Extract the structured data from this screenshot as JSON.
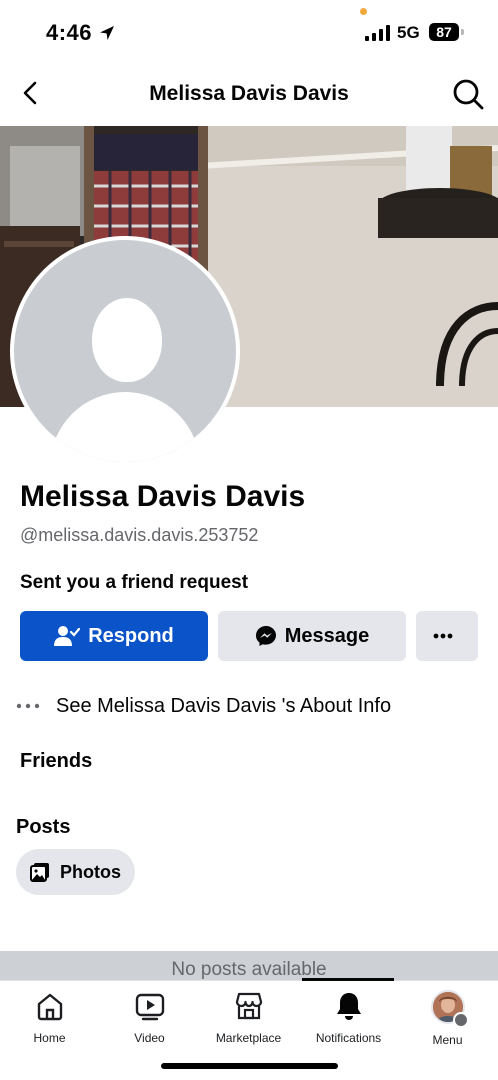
{
  "status_bar": {
    "time": "4:46",
    "network": "5G",
    "battery": "87",
    "icons": [
      "location-arrow-icon",
      "signal-icon",
      "battery-icon"
    ]
  },
  "header": {
    "title": "Melissa Davis Davis",
    "back_icon": "chevron-left-icon",
    "search_icon": "search-icon"
  },
  "profile": {
    "name": "Melissa Davis Davis",
    "handle": "@melissa.davis.davis.253752",
    "request_text": "Sent you a friend request",
    "avatar": "default-avatar-placeholder"
  },
  "actions": {
    "respond_label": "Respond",
    "message_label": "Message",
    "more_icon": "ellipsis-icon",
    "colors": {
      "primary": "#0a53c9",
      "secondary": "#e4e6eb"
    }
  },
  "about": {
    "label": "See Melissa Davis Davis 's About Info"
  },
  "sections": {
    "friends_title": "Friends",
    "posts_title": "Posts",
    "photos_label": "Photos"
  },
  "no_posts": "No posts available",
  "tabs": [
    {
      "label": "Home",
      "icon": "home-icon"
    },
    {
      "label": "Video",
      "icon": "video-icon"
    },
    {
      "label": "Marketplace",
      "icon": "marketplace-icon"
    },
    {
      "label": "Notifications",
      "icon": "bell-icon",
      "active": true
    },
    {
      "label": "Menu",
      "icon": "profile-avatar-icon"
    }
  ]
}
